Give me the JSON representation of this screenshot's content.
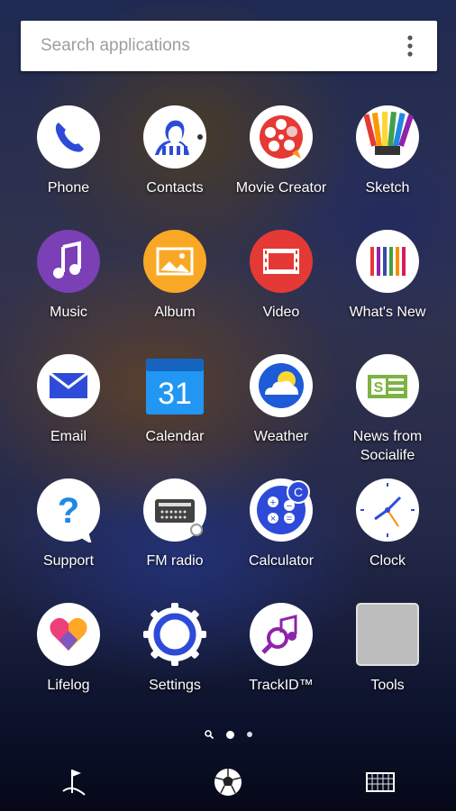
{
  "search": {
    "placeholder": "Search applications",
    "menu_icon": "more-vert-icon"
  },
  "apps": [
    {
      "label": "Phone",
      "icon": "phone-icon"
    },
    {
      "label": "Contacts",
      "icon": "contacts-icon"
    },
    {
      "label": "Movie Creator",
      "icon": "movie-creator-icon"
    },
    {
      "label": "Sketch",
      "icon": "sketch-icon"
    },
    {
      "label": "Music",
      "icon": "music-icon"
    },
    {
      "label": "Album",
      "icon": "album-icon"
    },
    {
      "label": "Video",
      "icon": "video-icon"
    },
    {
      "label": "What's New",
      "icon": "whats-new-icon"
    },
    {
      "label": "Email",
      "icon": "email-icon"
    },
    {
      "label": "Calendar",
      "icon": "calendar-icon",
      "badge": "31"
    },
    {
      "label": "Weather",
      "icon": "weather-icon"
    },
    {
      "label": "News from\nSocialife",
      "icon": "news-icon"
    },
    {
      "label": "Support",
      "icon": "support-icon"
    },
    {
      "label": "FM radio",
      "icon": "fm-radio-icon"
    },
    {
      "label": "Calculator",
      "icon": "calculator-icon"
    },
    {
      "label": "Clock",
      "icon": "clock-icon"
    },
    {
      "label": "Lifelog",
      "icon": "lifelog-icon"
    },
    {
      "label": "Settings",
      "icon": "settings-icon"
    },
    {
      "label": "TrackID™",
      "icon": "trackid-icon"
    },
    {
      "label": "Tools",
      "icon": "folder-icon"
    }
  ],
  "pager": {
    "pages": 2,
    "active": 1
  },
  "dock": [
    {
      "icon": "corner-flag-icon"
    },
    {
      "icon": "soccer-ball-icon"
    },
    {
      "icon": "goal-net-icon"
    }
  ]
}
